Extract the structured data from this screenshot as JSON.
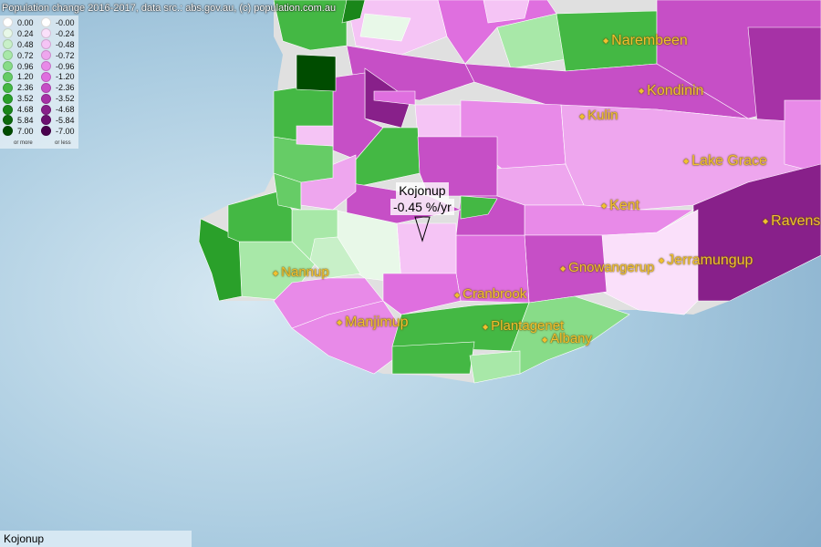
{
  "title": "Population change 2016-2017, data src.: abs.gov.au, (c) population.com.au",
  "legend": {
    "positive": [
      "0.00",
      "0.24",
      "0.48",
      "0.72",
      "0.96",
      "1.20",
      "2.36",
      "3.52",
      "4.68",
      "5.84",
      "7.00"
    ],
    "negative": [
      "-0.00",
      "-0.24",
      "-0.48",
      "-0.72",
      "-0.96",
      "-1.20",
      "-2.36",
      "-3.52",
      "-4.68",
      "-5.84",
      "-7.00"
    ],
    "positive_colors": [
      "#ffffff",
      "#e8f8e8",
      "#c8f0c8",
      "#a8e8a8",
      "#88dc88",
      "#66cc66",
      "#44b844",
      "#2aa02a",
      "#1a861a",
      "#0e6a0e",
      "#004c00"
    ],
    "negative_colors": [
      "#ffffff",
      "#fae0fa",
      "#f5c4f5",
      "#eea6ee",
      "#e88ae8",
      "#df6fdf",
      "#c64fc6",
      "#a632a6",
      "#88208a",
      "#6c1070",
      "#4a004e"
    ],
    "more_note": "or more",
    "less_note": "or less"
  },
  "places": [
    {
      "name": "Narembeen"
    },
    {
      "name": "Kondinin"
    },
    {
      "name": "Kulin"
    },
    {
      "name": "Lake Grace"
    },
    {
      "name": "Ravens"
    },
    {
      "name": "Kent"
    },
    {
      "name": "Gnowangerup"
    },
    {
      "name": "Jerramungup"
    },
    {
      "name": "Nannup"
    },
    {
      "name": "Cranbrook"
    },
    {
      "name": "Manjimup"
    },
    {
      "name": "Plantagenet"
    },
    {
      "name": "Albany"
    }
  ],
  "tooltip": {
    "name": "Kojonup",
    "value": "-0.45 %/yr"
  },
  "status": {
    "selected": "Kojonup"
  },
  "colors": {
    "ocean": "#9fc3da",
    "label": "#f0c030"
  }
}
